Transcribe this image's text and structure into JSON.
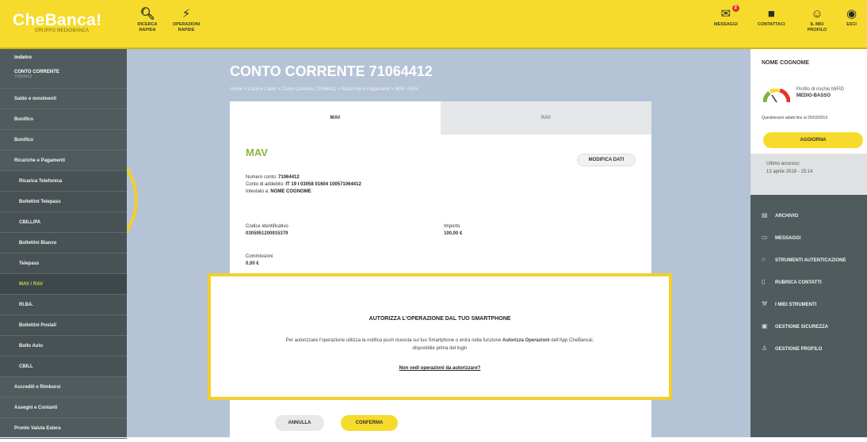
{
  "brand": {
    "name": "CheBanca!",
    "sub": "GRUPPO MEDIOBANCA"
  },
  "topbar": {
    "left_tools": [
      {
        "icon": "search-icon",
        "label": "RICERCA RAPIDA"
      },
      {
        "icon": "lightning-icon",
        "label": "OPERAZIONI RAPIDE"
      }
    ],
    "right_tools": [
      {
        "icon": "mail-icon",
        "label": "MESSAGGI",
        "badge": "2"
      },
      {
        "icon": "chat-icon",
        "label": "CONTATTACI"
      },
      {
        "icon": "user-icon",
        "label": "IL MIO PROFILO"
      },
      {
        "icon": "logout-icon",
        "label": "ESCI"
      }
    ]
  },
  "sidebar": {
    "top_label": "Indietro",
    "top_title": "CONTO CORRENTE",
    "top_sub": "71064412",
    "items": [
      {
        "label": "Saldo e movimenti",
        "kind": "main"
      },
      {
        "label": "Bonifico",
        "kind": "main"
      },
      {
        "label": "Bonifico",
        "kind": "main"
      },
      {
        "label": "Ricariche e Pagamenti",
        "kind": "main"
      },
      {
        "label": "Ricarica Telefonica",
        "kind": "sub"
      },
      {
        "label": "Bollettini Telepass",
        "kind": "sub"
      },
      {
        "label": "CBILL/PA",
        "kind": "sub"
      },
      {
        "label": "Bollettini Bianco",
        "kind": "sub"
      },
      {
        "label": "Telepass",
        "kind": "sub"
      },
      {
        "label": "MAV / RAV",
        "kind": "active"
      },
      {
        "label": "RI.BA.",
        "kind": "sub"
      },
      {
        "label": "Bollettini Postali",
        "kind": "sub"
      },
      {
        "label": "Bollo Auto",
        "kind": "sub"
      },
      {
        "label": "CBILL",
        "kind": "sub"
      },
      {
        "label": "Accrediti e Rimborsi",
        "kind": "main"
      },
      {
        "label": "Assegni e Contanti",
        "kind": "main"
      },
      {
        "label": "Pronto Valuta Estera",
        "kind": "main"
      }
    ]
  },
  "main": {
    "title": "CONTO CORRENTE 71064412",
    "breadcrumb": "Home  >  Conti e Carte  >  Conto Corrente 71064412  >  Ricariche e Pagamenti  >  MAV / RAV",
    "tabs": [
      {
        "label": "MAV",
        "active": true
      },
      {
        "label": "RAV",
        "active": false
      }
    ],
    "section_title": "MAV",
    "edit_label": "MODIFICA DATI",
    "account_lines": [
      {
        "k": "Numero conto: ",
        "v": "71064412"
      },
      {
        "k": "Conto di addebito: ",
        "v": "IT 19 I 03058 01604 100571064412"
      },
      {
        "k": "Intestato a: ",
        "v": "NOME COGNOME"
      }
    ],
    "code_label": "Codice Identificativo",
    "code_value": "0305951200915379",
    "amount_label": "Importo",
    "amount_value": "100,00 €",
    "commission_label": "Commissioni",
    "commission_value": "0,00 €",
    "cancel_label": "ANNULLA",
    "confirm_label": "CONFERMA"
  },
  "modal": {
    "title": "AUTORIZZA L'OPERAZIONE DAL TUO SMARTPHONE",
    "text_before": "Per autorizzare l'operazione utilizza la notifica push ricevuta sul tuo Smartphone o entra nella funzione ",
    "text_bold": "Autorizza Operazioni",
    "text_after": " dell'App CheBanca!,",
    "text_line2": "disponibile prima del login",
    "link": "Non vedi operazioni da autorizzare?"
  },
  "right": {
    "user_name": "NOME COGNOME",
    "profile_line1": "Profilo di rischio MiFID",
    "profile_line2": "MEDIO-BASSO",
    "questionnaire": "Questionario adatti fino al 25/03/2019",
    "update_label": "AGGIORNA",
    "last_access_label": "Ultimo accesso:",
    "last_access_value": "13 aprile 2018 - 15:14",
    "menu": [
      {
        "icon": "archive-icon",
        "label": "ARCHIVIO"
      },
      {
        "icon": "message-icon",
        "label": "MESSAGGI"
      },
      {
        "icon": "shield-icon",
        "label": "STRUMENTI AUTENTICAZIONE"
      },
      {
        "icon": "contacts-icon",
        "label": "RUBRICA CONTATTI"
      },
      {
        "icon": "tools-icon",
        "label": "I MIEI STRUMENTI"
      },
      {
        "icon": "lock-icon",
        "label": "GESTIONE SICUREZZA"
      },
      {
        "icon": "profile-icon",
        "label": "GESTIONE PROFILO"
      }
    ]
  },
  "colors": {
    "brand_yellow": "#f6db2c",
    "sidebar": "#505b5e",
    "main_bg": "#b4c3d6",
    "accent_green": "#8cb63c"
  }
}
